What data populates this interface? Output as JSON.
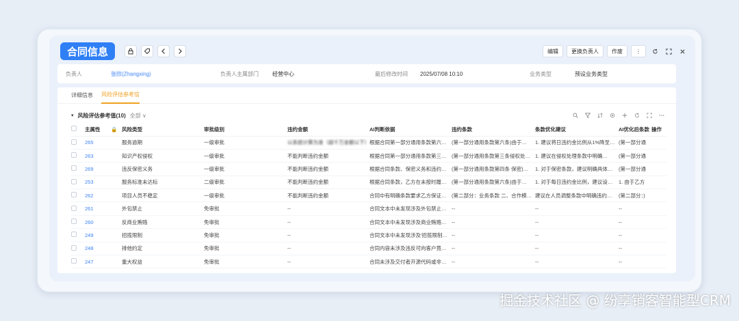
{
  "header": {
    "title": "合同信息",
    "actions": [
      "编辑",
      "更换负责人",
      "作废"
    ],
    "more_label": "⋮"
  },
  "info": [
    {
      "label": "负责人",
      "value": "张欣(Zhangxing)"
    },
    {
      "label": "负责人主属部门",
      "value": "经营中心"
    },
    {
      "label": "最后修改时间",
      "value": "2025/07/08 10:10"
    },
    {
      "label": "业务类型",
      "value": "预设业务类型"
    }
  ],
  "tabs": [
    "详细信息",
    "风险评估参考信"
  ],
  "section": {
    "title": "风险评估参考值(10)",
    "filter": "全部 ∨"
  },
  "table": {
    "headers": [
      "主属性",
      "",
      "风险类型",
      "审批级别",
      "违约金额",
      "AI判断依据",
      "违约条款",
      "条款优化建议",
      "AI优化后条款",
      "操作"
    ],
    "rows": [
      {
        "id": "265",
        "type": "服务逾期",
        "level": "一级审批",
        "amount": "以系统计算为准（超千万金额以下）",
        "basis": "根据合同第一部分通用条款第六…",
        "clause": "(第一部分通用条款第六条)由于…",
        "advice": "1. 建议将日违约金比例从1%降至…",
        "ai": "(第一部分通"
      },
      {
        "id": "263",
        "type": "知识产权侵权",
        "level": "一级审批",
        "amount": "不能判断违约金额",
        "basis": "根据合同第一部分通用条款第三…",
        "clause": "(第一部分通用条款第三条侵权处…",
        "advice": "1. 建议在侵权处理条款中明确…",
        "ai": "(第一部分通"
      },
      {
        "id": "269",
        "type": "违反保密义务",
        "level": "一级审批",
        "amount": "不能判断违约金额",
        "basis": "根据合同条款、保密义务和违约…",
        "clause": "(第一部分通用条款第四条 保密)…",
        "advice": "1. 对于保密条款，建议明确具体…",
        "ai": "(第一部分通"
      },
      {
        "id": "253",
        "type": "服务标准未达标",
        "level": "二级审批",
        "amount": "不能判断违约金额",
        "basis": "根据合同条款，乙方在未按时履…",
        "clause": "(第一部分通用条款第六条)由于…",
        "advice": "1. 对于每日违约金比例，建议设…",
        "ai": "1. 由于乙方"
      },
      {
        "id": "262",
        "type": "项目人员不稳定",
        "level": "一级审批",
        "amount": "不能判断违约金额",
        "basis": "合同中有明确条款要求乙方保证…",
        "clause": "(第二部分：业务条款 二、合作模…",
        "advice": "建议在人员调整条款中明确违约…",
        "ai": "(第二部分：)"
      },
      {
        "id": "261",
        "type": "外包禁止",
        "level": "免审批",
        "amount": "--",
        "basis": "合同文本中未发现涉及外包禁止…",
        "clause": "--",
        "advice": "--",
        "ai": "--"
      },
      {
        "id": "260",
        "type": "反商业贿赂",
        "level": "免审批",
        "amount": "--",
        "basis": "合同文本中未发现涉及商业贿赂…",
        "clause": "--",
        "advice": "--",
        "ai": "--"
      },
      {
        "id": "249",
        "type": "招揽限制",
        "level": "免审批",
        "amount": "--",
        "basis": "合同文本中未发现涉及'招揽限制…",
        "clause": "--",
        "advice": "--",
        "ai": "--"
      },
      {
        "id": "248",
        "type": "排他约定",
        "level": "免审批",
        "amount": "--",
        "basis": "合同内容未涉及违反可向客户竟…",
        "clause": "--",
        "advice": "--",
        "ai": "--"
      },
      {
        "id": "247",
        "type": "重大权益",
        "level": "免审批",
        "amount": "--",
        "basis": "合同未涉及交付者开源代码或非…",
        "clause": "--",
        "advice": "--",
        "ai": "--"
      }
    ]
  },
  "watermark": "掘金技术社区 @ 纷享销客智能型CRM",
  "colors": {
    "accent": "#2f7ff5",
    "tab_active": "#f0a020",
    "link": "#3b82f6"
  }
}
